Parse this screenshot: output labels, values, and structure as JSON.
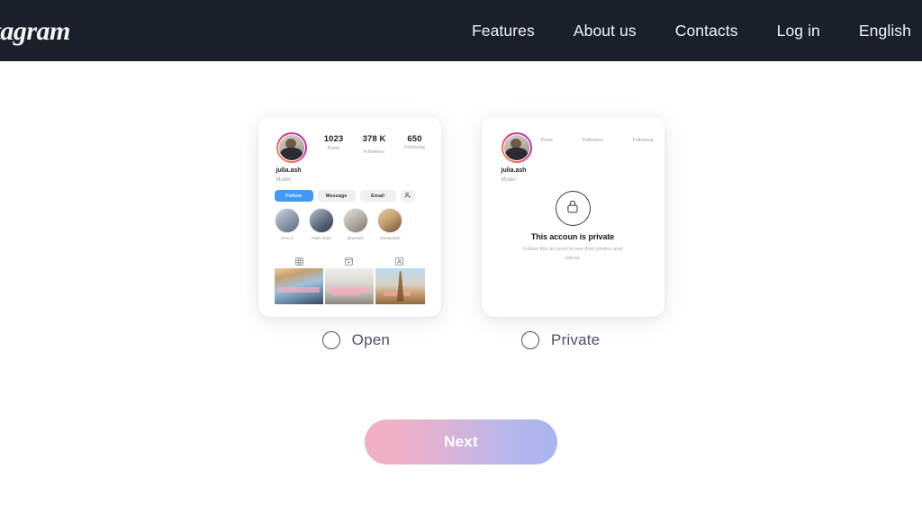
{
  "navbar": {
    "brand": "Instagram",
    "brand_visible": "agram",
    "bg_color": "#1b1f2a",
    "links": [
      {
        "label": "Features"
      },
      {
        "label": "About us"
      },
      {
        "label": "Contacts"
      },
      {
        "label": "Log in"
      },
      {
        "label": "English"
      }
    ]
  },
  "cards": {
    "open": {
      "avatar_icon": "user-avatar",
      "stats": [
        {
          "value": "1023",
          "label": "Posts"
        },
        {
          "value": "378 K",
          "label": "Followers"
        },
        {
          "value": "650",
          "label": "Following"
        }
      ],
      "username": "julia.ash",
      "bio": "Model",
      "buttons": [
        {
          "label": "Follow",
          "style": "primary",
          "color": "#3f9bf5"
        },
        {
          "label": "Message",
          "style": "secondary"
        },
        {
          "label": "Email",
          "style": "secondary"
        },
        {
          "label": "·⦿",
          "style": "icon",
          "icon": "add-person-icon"
        }
      ],
      "highlights": [
        {
          "label": "NYC II"
        },
        {
          "label": "Paris 2022"
        },
        {
          "label": "Brussels"
        },
        {
          "label": "Amsterdam"
        }
      ],
      "tabs": [
        {
          "icon": "grid-icon"
        },
        {
          "icon": "reels-icon"
        },
        {
          "icon": "tagged-icon"
        }
      ],
      "photos": [
        {
          "caption": "photo-architecture-1"
        },
        {
          "caption": "photo-architecture-2"
        },
        {
          "caption": "photo-eiffel-tower"
        }
      ]
    },
    "private": {
      "avatar_icon": "user-avatar",
      "stats": [
        {
          "label": "Posts"
        },
        {
          "label": "Followers"
        },
        {
          "label": "Following"
        }
      ],
      "username": "julia.ash",
      "bio": "Model",
      "lock_icon": "lock-icon",
      "title": "This accoun is private",
      "subtitle": "Follow this account to see their photos and videos."
    }
  },
  "options": {
    "items": [
      {
        "label": "Open",
        "selected": false
      },
      {
        "label": "Private",
        "selected": false
      }
    ]
  },
  "next_button": {
    "label": "Next",
    "gradient_start": "#f2afc4",
    "gradient_end": "#a9b4f0"
  }
}
